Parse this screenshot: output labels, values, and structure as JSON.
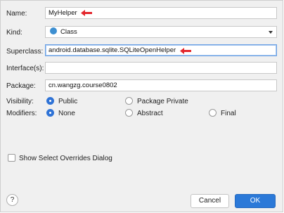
{
  "form": {
    "name": {
      "label": "Name:",
      "value": "MyHelper"
    },
    "kind": {
      "label": "Kind:",
      "value": "Class"
    },
    "superclass": {
      "label": "Superclass:",
      "value": "android.database.sqlite.SQLiteOpenHelper"
    },
    "interfaces": {
      "label": "Interface(s):",
      "value": ""
    },
    "package": {
      "label": "Package:",
      "value": "cn.wangzg.course0802"
    }
  },
  "visibility": {
    "label": "Visibility:",
    "options": [
      "Public",
      "Package Private"
    ],
    "selected": "Public"
  },
  "modifiers": {
    "label": "Modifiers:",
    "options": [
      "None",
      "Abstract",
      "Final"
    ],
    "selected": "None"
  },
  "overrides": {
    "label": "Show Select Overrides Dialog",
    "checked": false
  },
  "footer": {
    "help": "?",
    "cancel": "Cancel",
    "ok": "OK"
  },
  "colors": {
    "accent": "#2b79d8",
    "annotation_arrow": "#e3262c"
  }
}
